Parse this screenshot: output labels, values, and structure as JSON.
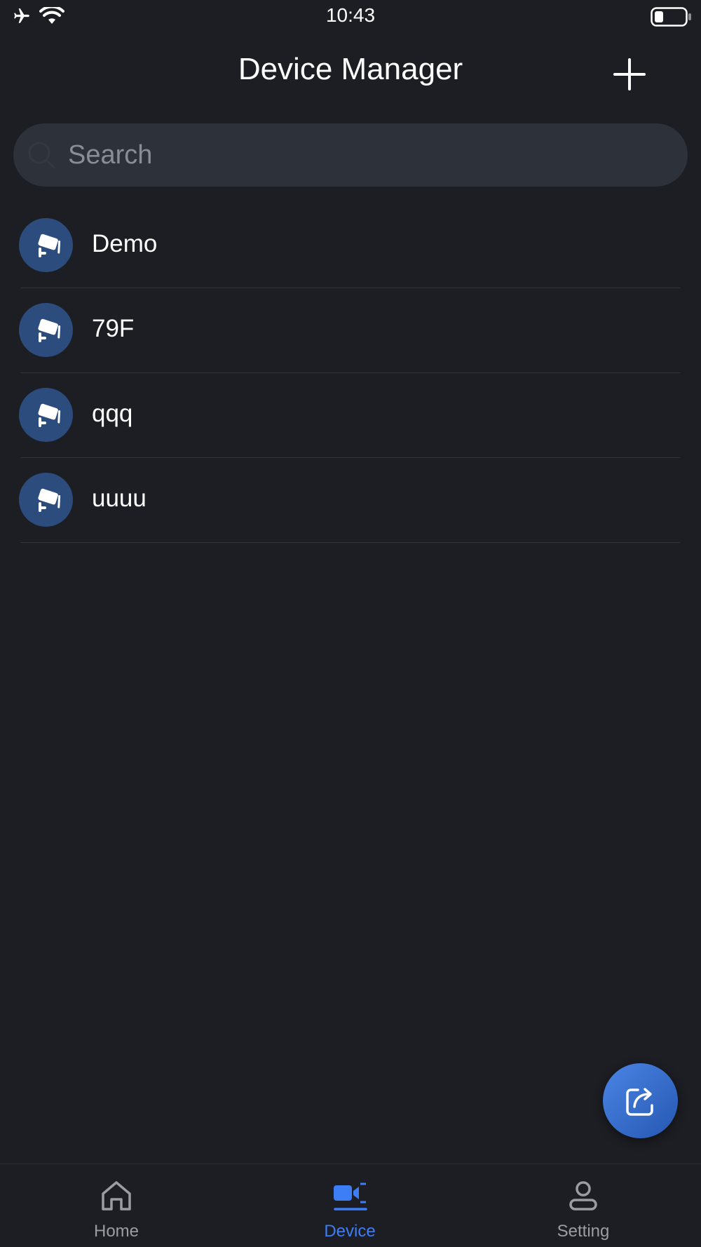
{
  "status_bar": {
    "time": "10:43",
    "icons": [
      "airplane-icon",
      "wifi-icon",
      "battery-icon"
    ]
  },
  "header": {
    "title": "Device Manager",
    "add_icon": "plus-icon"
  },
  "search": {
    "placeholder": "Search",
    "value": ""
  },
  "devices": [
    {
      "name": "Demo",
      "icon": "camera-icon"
    },
    {
      "name": "79F",
      "icon": "camera-icon"
    },
    {
      "name": "qqq",
      "icon": "camera-icon"
    },
    {
      "name": "uuuu",
      "icon": "camera-icon"
    }
  ],
  "fab": {
    "icon": "share-icon"
  },
  "tabs": [
    {
      "label": "Home",
      "icon": "home-icon",
      "active": false
    },
    {
      "label": "Device",
      "icon": "video-camera-icon",
      "active": true
    },
    {
      "label": "Setting",
      "icon": "user-icon",
      "active": false
    }
  ],
  "colors": {
    "background": "#1c1e23",
    "search_bg": "#2d3139",
    "accent": "#3d7df5",
    "avatar_bg": "#2b4c7c",
    "muted": "#9a9da3"
  }
}
